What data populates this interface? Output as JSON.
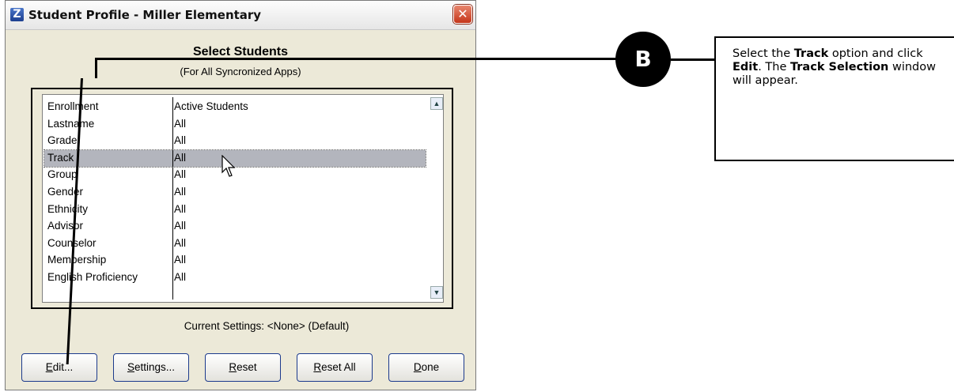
{
  "window": {
    "title": "Student Profile - Miller Elementary",
    "close_symbol": "✕",
    "app_icon_glyph": "Z"
  },
  "panel": {
    "title": "Select Students",
    "subtitle": "(For All Syncronized Apps)"
  },
  "list": {
    "rows": [
      {
        "field": "Enrollment",
        "value": "Active Students"
      },
      {
        "field": "Lastname",
        "value": "All"
      },
      {
        "field": "Grade",
        "value": "All"
      },
      {
        "field": "Track",
        "value": "All"
      },
      {
        "field": "Group",
        "value": "All"
      },
      {
        "field": "Gender",
        "value": "All"
      },
      {
        "field": "Ethnicity",
        "value": "All"
      },
      {
        "field": "Advisor",
        "value": "All"
      },
      {
        "field": "Counselor",
        "value": "All"
      },
      {
        "field": "Membership",
        "value": "All"
      },
      {
        "field": "English Proficiency",
        "value": "All"
      }
    ],
    "selected_row": "Track"
  },
  "current_settings": "Current Settings: <None> (Default)",
  "buttons": {
    "edit": {
      "mnemonic": "E",
      "rest": "dit..."
    },
    "settings": {
      "mnemonic": "S",
      "rest": "ettings..."
    },
    "reset": {
      "mnemonic": "R",
      "rest": "eset"
    },
    "reset_all": {
      "mnemonic": "R",
      "rest": "eset All"
    },
    "done": {
      "mnemonic": "D",
      "rest": "one"
    }
  },
  "callout": {
    "badge": "B",
    "text_parts": [
      {
        "t": "Select the ",
        "b": false
      },
      {
        "t": "Track",
        "b": true
      },
      {
        "t": " option and click ",
        "b": false
      },
      {
        "t": "Edit",
        "b": true
      },
      {
        "t": ". The ",
        "b": false
      },
      {
        "t": "Track Selection",
        "b": true
      },
      {
        "t": " window will appear.",
        "b": false
      }
    ]
  },
  "colors": {
    "selected_row": "#b3b5bd",
    "close_button": "#c5361a",
    "dialog_background": "#ece9d8"
  }
}
